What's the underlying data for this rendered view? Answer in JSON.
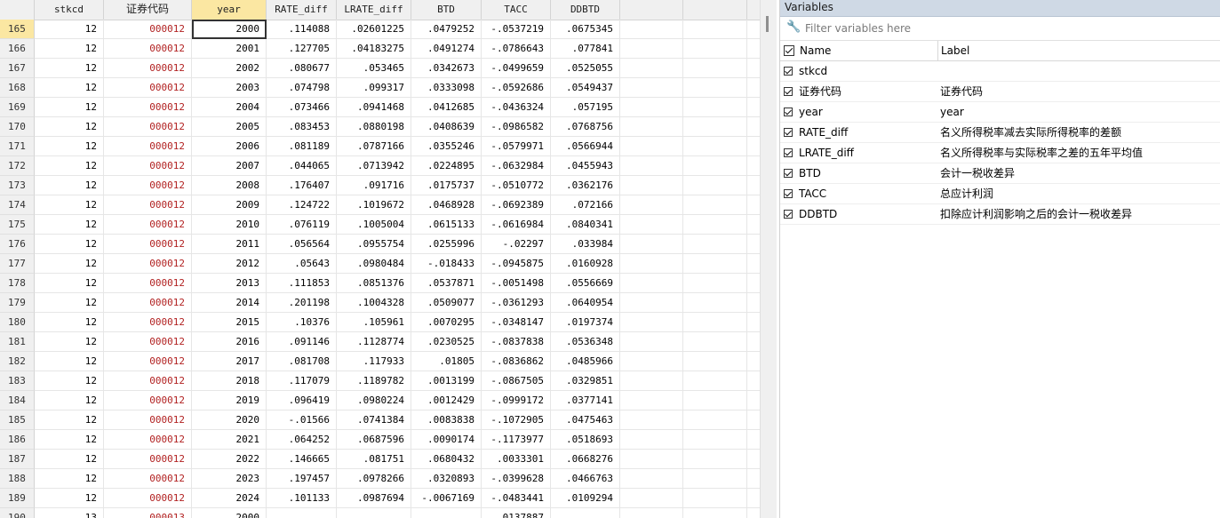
{
  "grid": {
    "columns": [
      "stkcd",
      "证券代码",
      "year",
      "RATE_diff",
      "LRATE_diff",
      "BTD",
      "TACC",
      "DDBTD"
    ],
    "rows": [
      {
        "n": "165",
        "c": [
          "12",
          "000012",
          "2000",
          ".114088",
          ".02601225",
          ".0479252",
          "-.0537219",
          ".0675345"
        ]
      },
      {
        "n": "166",
        "c": [
          "12",
          "000012",
          "2001",
          ".127705",
          ".04183275",
          ".0491274",
          "-.0786643",
          ".077841"
        ]
      },
      {
        "n": "167",
        "c": [
          "12",
          "000012",
          "2002",
          ".080677",
          ".053465",
          ".0342673",
          "-.0499659",
          ".0525055"
        ]
      },
      {
        "n": "168",
        "c": [
          "12",
          "000012",
          "2003",
          ".074798",
          ".099317",
          ".0333098",
          "-.0592686",
          ".0549437"
        ]
      },
      {
        "n": "169",
        "c": [
          "12",
          "000012",
          "2004",
          ".073466",
          ".0941468",
          ".0412685",
          "-.0436324",
          ".057195"
        ]
      },
      {
        "n": "170",
        "c": [
          "12",
          "000012",
          "2005",
          ".083453",
          ".0880198",
          ".0408639",
          "-.0986582",
          ".0768756"
        ]
      },
      {
        "n": "171",
        "c": [
          "12",
          "000012",
          "2006",
          ".081189",
          ".0787166",
          ".0355246",
          "-.0579971",
          ".0566944"
        ]
      },
      {
        "n": "172",
        "c": [
          "12",
          "000012",
          "2007",
          ".044065",
          ".0713942",
          ".0224895",
          "-.0632984",
          ".0455943"
        ]
      },
      {
        "n": "173",
        "c": [
          "12",
          "000012",
          "2008",
          ".176407",
          ".091716",
          ".0175737",
          "-.0510772",
          ".0362176"
        ]
      },
      {
        "n": "174",
        "c": [
          "12",
          "000012",
          "2009",
          ".124722",
          ".1019672",
          ".0468928",
          "-.0692389",
          ".072166"
        ]
      },
      {
        "n": "175",
        "c": [
          "12",
          "000012",
          "2010",
          ".076119",
          ".1005004",
          ".0615133",
          "-.0616984",
          ".0840341"
        ]
      },
      {
        "n": "176",
        "c": [
          "12",
          "000012",
          "2011",
          ".056564",
          ".0955754",
          ".0255996",
          "-.02297",
          ".033984"
        ]
      },
      {
        "n": "177",
        "c": [
          "12",
          "000012",
          "2012",
          ".05643",
          ".0980484",
          "-.018433",
          "-.0945875",
          ".0160928"
        ]
      },
      {
        "n": "178",
        "c": [
          "12",
          "000012",
          "2013",
          ".111853",
          ".0851376",
          ".0537871",
          "-.0051498",
          ".0556669"
        ]
      },
      {
        "n": "179",
        "c": [
          "12",
          "000012",
          "2014",
          ".201198",
          ".1004328",
          ".0509077",
          "-.0361293",
          ".0640954"
        ]
      },
      {
        "n": "180",
        "c": [
          "12",
          "000012",
          "2015",
          ".10376",
          ".105961",
          ".0070295",
          "-.0348147",
          ".0197374"
        ]
      },
      {
        "n": "181",
        "c": [
          "12",
          "000012",
          "2016",
          ".091146",
          ".1128774",
          ".0230525",
          "-.0837838",
          ".0536348"
        ]
      },
      {
        "n": "182",
        "c": [
          "12",
          "000012",
          "2017",
          ".081708",
          ".117933",
          ".01805",
          "-.0836862",
          ".0485966"
        ]
      },
      {
        "n": "183",
        "c": [
          "12",
          "000012",
          "2018",
          ".117079",
          ".1189782",
          ".0013199",
          "-.0867505",
          ".0329851"
        ]
      },
      {
        "n": "184",
        "c": [
          "12",
          "000012",
          "2019",
          ".096419",
          ".0980224",
          ".0012429",
          "-.0999172",
          ".0377141"
        ]
      },
      {
        "n": "185",
        "c": [
          "12",
          "000012",
          "2020",
          "-.01566",
          ".0741384",
          ".0083838",
          "-.1072905",
          ".0475463"
        ]
      },
      {
        "n": "186",
        "c": [
          "12",
          "000012",
          "2021",
          ".064252",
          ".0687596",
          ".0090174",
          "-.1173977",
          ".0518693"
        ]
      },
      {
        "n": "187",
        "c": [
          "12",
          "000012",
          "2022",
          ".146665",
          ".081751",
          ".0680432",
          ".0033301",
          ".0668276"
        ]
      },
      {
        "n": "188",
        "c": [
          "12",
          "000012",
          "2023",
          ".197457",
          ".0978266",
          ".0320893",
          "-.0399628",
          ".0466763"
        ]
      },
      {
        "n": "189",
        "c": [
          "12",
          "000012",
          "2024",
          ".101133",
          ".0987694",
          "-.0067169",
          "-.0483441",
          ".0109294"
        ]
      },
      {
        "n": "190",
        "c": [
          "13",
          "000013",
          "2000",
          "",
          "",
          "",
          ".0137887",
          ""
        ]
      }
    ]
  },
  "variables": {
    "title": "Variables",
    "filter_placeholder": "Filter variables here",
    "header_name": "Name",
    "header_label": "Label",
    "items": [
      {
        "name": "stkcd",
        "label": ""
      },
      {
        "name": "证券代码",
        "label": "证券代码"
      },
      {
        "name": "year",
        "label": "year"
      },
      {
        "name": "RATE_diff",
        "label": "名义所得税率减去实际所得税率的差额"
      },
      {
        "name": "LRATE_diff",
        "label": "名义所得税率与实际税率之差的五年平均值"
      },
      {
        "name": "BTD",
        "label": "会计一税收差异"
      },
      {
        "name": "TACC",
        "label": "总应计利润"
      },
      {
        "name": "DDBTD",
        "label": "扣除应计利润影响之后的会计一税收差异"
      }
    ]
  },
  "colors": {
    "string_value": "#b22222",
    "selected_header": "#fbe7a2",
    "pane_title": "#cfd9e5"
  },
  "icons": {
    "filter": "wrench-icon",
    "checkbox": "checkbox-checked-icon"
  }
}
